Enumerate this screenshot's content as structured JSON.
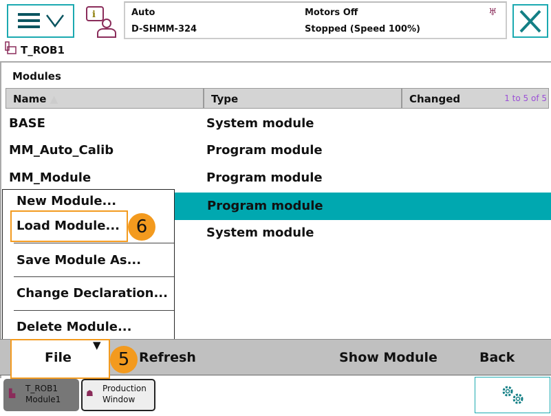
{
  "header": {
    "mode": "Auto",
    "controller": "D-SHMM-324",
    "motors": "Motors Off",
    "state": "Stopped (Speed 100%)",
    "task": "T_ROB1"
  },
  "section_title": "Modules",
  "table": {
    "columns": [
      "Name",
      "Type",
      "Changed"
    ],
    "pagination": "1 to 5 of 5",
    "rows": [
      {
        "name": "BASE",
        "type": "System module"
      },
      {
        "name": "MM_Auto_Calib",
        "type": "Program module"
      },
      {
        "name": "MM_Module",
        "type": "Program module"
      },
      {
        "name": "",
        "type": "Program module",
        "selected": true
      },
      {
        "name": "",
        "type": "System module"
      }
    ]
  },
  "file_menu": {
    "items": [
      "New Module...",
      "Load Module...",
      "Save Module As...",
      "Change Declaration...",
      "Delete Module..."
    ]
  },
  "annotations": {
    "step5": "5",
    "step6": "6"
  },
  "toolbar": {
    "file": "File",
    "refresh": "Refresh",
    "show_module": "Show Module",
    "back": "Back"
  },
  "taskbar": {
    "task_line1": "T_ROB1",
    "task_line2": "Module1",
    "prod_line1": "Production",
    "prod_line2": "Window"
  },
  "colors": {
    "accent": "#1aa9b0",
    "selected_row": "#00a8b0",
    "highlight": "#f39a1e",
    "pagination": "#9b4fd6"
  }
}
